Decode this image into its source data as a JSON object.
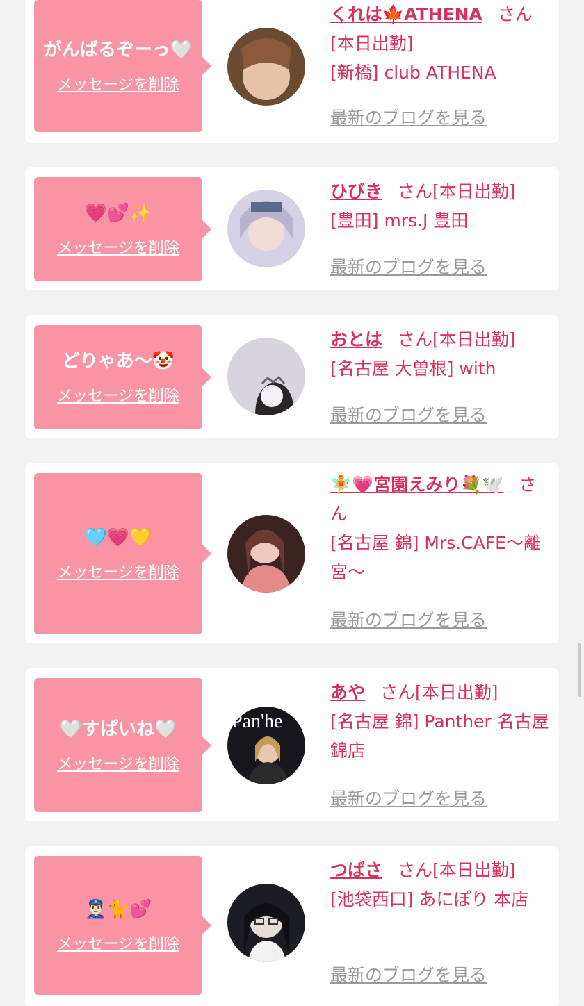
{
  "cards": [
    {
      "message": "がんばるぞーっ🤍",
      "delete_label": "メッセージを削除",
      "avatar": "avatar-photo",
      "name": "くれは🍁ATHENA",
      "san": "さん",
      "status": "[本日出勤]",
      "store": "[新橋] club ATHENA",
      "blog_label": "最新のブログを見る",
      "avatar_colors": [
        "#6b4a32",
        "#e9c3a8"
      ]
    },
    {
      "message": "💗💕✨",
      "delete_label": "メッセージを削除",
      "avatar": "avatar-photo",
      "name": "ひびき",
      "san": "さん",
      "status": "[本日出勤]",
      "store": "[豊田] mrs.J 豊田",
      "blog_label": "最新のブログを見る",
      "avatar_colors": [
        "#d6d2e6",
        "#f2dcd8"
      ]
    },
    {
      "message": "どりゃあ〜🤡",
      "delete_label": "メッセージを削除",
      "avatar": "avatar-photo",
      "name": "おとは",
      "san": "さん",
      "status": "[本日出勤]",
      "store": "[名古屋 大曽根] with",
      "blog_label": "最新のブログを見る",
      "avatar_colors": [
        "#d7d4de",
        "#f3f0f5"
      ]
    },
    {
      "message": "🩵💗💛",
      "delete_label": "メッセージを削除",
      "avatar": "avatar-photo",
      "name": "🧚💗宮園えみり💐🕊️",
      "san": "さん",
      "status": "",
      "store": "[名古屋 錦] Mrs.CAFE〜離宮〜",
      "blog_label": "最新のブログを見る",
      "avatar_colors": [
        "#3a2320",
        "#f0c8bd"
      ]
    },
    {
      "message": "🤍すぱいね🤍",
      "delete_label": "メッセージを削除",
      "avatar": "avatar-photo",
      "name": "あや",
      "san": "さん",
      "status": "[本日出勤]",
      "store": "[名古屋 錦] Panther 名古屋錦店",
      "blog_label": "最新のブログを見る",
      "avatar_colors": [
        "#16161c",
        "#e8c7b0"
      ]
    },
    {
      "message": "👮🏻‍♂️🐈💕",
      "delete_label": "メッセージを削除",
      "avatar": "avatar-photo",
      "name": "つばさ",
      "san": "さん",
      "status": "[本日出勤]",
      "store": "[池袋西口] あにぽり 本店",
      "blog_label": "最新のブログを見る",
      "avatar_colors": [
        "#1c1c24",
        "#e6ddd8"
      ]
    }
  ]
}
